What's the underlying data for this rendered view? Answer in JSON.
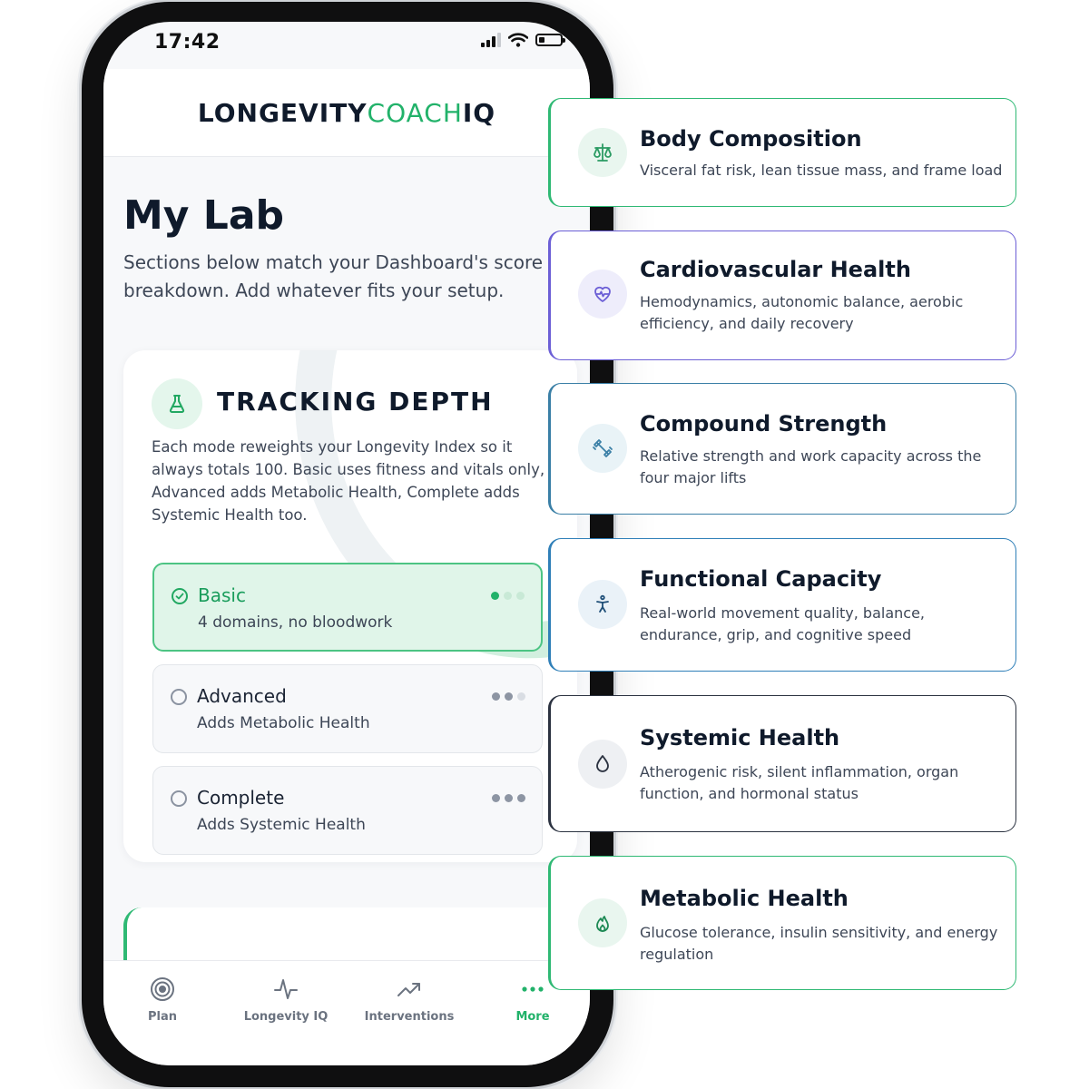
{
  "status_bar": {
    "time": "17:42"
  },
  "app": {
    "brand_part1": "LONGEVITY",
    "brand_part2": "COACH",
    "brand_part3": "IQ"
  },
  "page": {
    "title": "My Lab",
    "subtitle": "Sections below match your Dashboard's score breakdown. Add whatever fits your setup."
  },
  "tracking_depth": {
    "icon": "flask-icon",
    "title": "TRACKING DEPTH",
    "description": "Each mode reweights your Longevity Index so it always totals 100. Basic uses fitness and vitals only, Advanced adds Metabolic Health, Complete adds Systemic Health too.",
    "options": [
      {
        "name": "Basic",
        "description": "4 domains, no bloodwork",
        "selected": true,
        "level": 1
      },
      {
        "name": "Advanced",
        "description": "Adds Metabolic Health",
        "selected": false,
        "level": 2
      },
      {
        "name": "Complete",
        "description": "Adds Systemic Health",
        "selected": false,
        "level": 3
      }
    ]
  },
  "tab_bar": {
    "tabs": [
      {
        "label": "Plan",
        "icon": "target-icon",
        "active": false
      },
      {
        "label": "Longevity IQ",
        "icon": "pulse-icon",
        "active": false
      },
      {
        "label": "Interventions",
        "icon": "trend-up-icon",
        "active": false
      },
      {
        "label": "More",
        "icon": "more-dots-icon",
        "active": true
      }
    ]
  },
  "features": [
    {
      "title": "Body Composition",
      "description": "Visceral fat risk, lean tissue mass, and frame load",
      "icon": "scale-icon",
      "accent": "#2fb974"
    },
    {
      "title": "Cardiovascular Health",
      "description": "Hemodynamics, autonomic balance, aerobic efficiency, and daily recovery",
      "icon": "heart-pulse-icon",
      "accent": "#6c5fd6"
    },
    {
      "title": "Compound Strength",
      "description": "Relative strength and work capacity across the four major lifts",
      "icon": "dumbbell-icon",
      "accent": "#3a7fa6"
    },
    {
      "title": "Functional Capacity",
      "description": "Real-world movement quality, balance, endurance, grip, and cognitive speed",
      "icon": "person-icon",
      "accent": "#2f7fb8"
    },
    {
      "title": "Systemic Health",
      "description": "Atherogenic risk, silent inflammation, organ function, and hormonal status",
      "icon": "droplet-icon",
      "accent": "#2b3240"
    },
    {
      "title": "Metabolic Health",
      "description": "Glucose tolerance, insulin sensitivity, and energy regulation",
      "icon": "flame-icon",
      "accent": "#2fb974"
    }
  ]
}
